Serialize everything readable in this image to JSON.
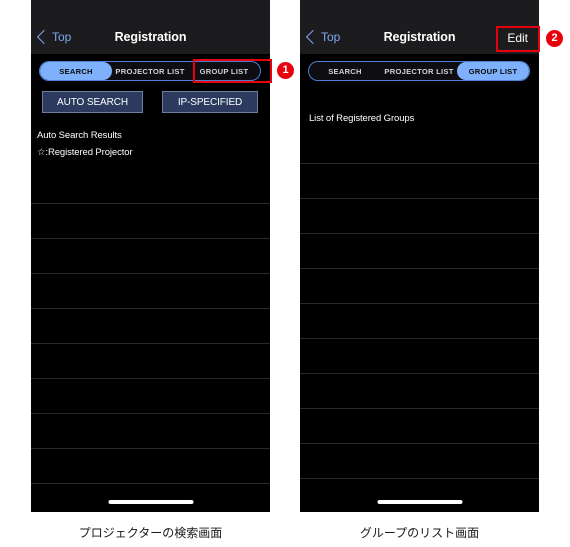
{
  "panels": [
    {
      "id": "projector-search",
      "caption": "プロジェクターの検索画面",
      "nav": {
        "back_label": "Top",
        "title": "Registration",
        "action_label": ""
      },
      "segmented": {
        "options": [
          "SEARCH",
          "PROJECTOR LIST",
          "GROUP LIST"
        ],
        "selected": "SEARCH"
      },
      "buttons": [
        {
          "label": "AUTO SEARCH"
        },
        {
          "label": "IP-SPECIFIED"
        }
      ],
      "labels": [
        "Auto Search Results",
        "☆:Registered Projector"
      ],
      "rows_count": 9
    },
    {
      "id": "group-list",
      "caption": "グループのリスト画面",
      "nav": {
        "back_label": "Top",
        "title": "Registration",
        "action_label": "Edit"
      },
      "segmented": {
        "options": [
          "SEARCH",
          "PROJECTOR LIST",
          "GROUP LIST"
        ],
        "selected": "GROUP LIST"
      },
      "labels": [
        "List of Registered Groups"
      ],
      "rows_count": 10
    }
  ],
  "annotations": [
    {
      "id": "callout-1",
      "number": "1",
      "target": "GROUP LIST"
    },
    {
      "id": "callout-2",
      "number": "2",
      "target": "Edit"
    }
  ],
  "colors": {
    "accent_blue": "#7fb0fb",
    "link_blue": "#7da7f0",
    "highlight_red": "#e8000d",
    "button_navy": "#2b3a5e",
    "screen_black": "#000000",
    "navbar_gray": "#1c1c1e"
  }
}
